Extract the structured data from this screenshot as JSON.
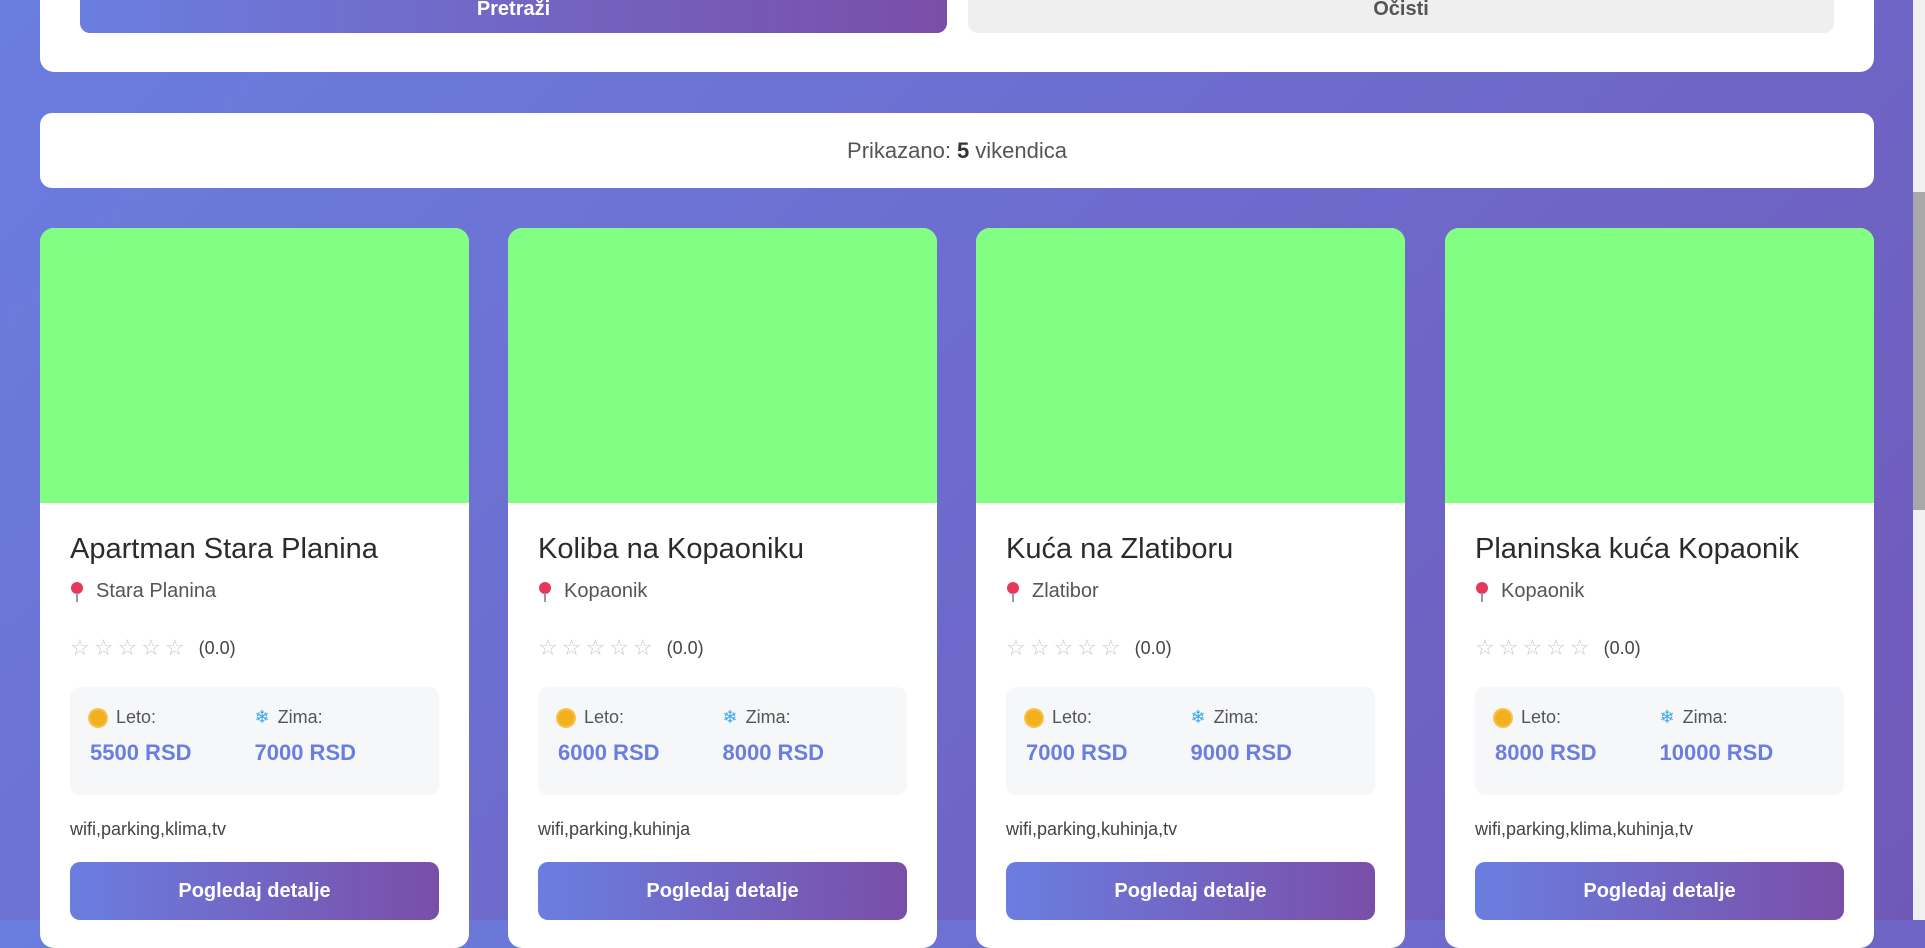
{
  "search": {
    "search_label": "Pretraži",
    "clear_label": "Očisti"
  },
  "results": {
    "prefix": "Prikazano:",
    "count": "5",
    "suffix": "vikendica"
  },
  "cards": [
    {
      "title": "Apartman Stara Planina",
      "location": "Stara Planina",
      "stars": "☆☆☆☆☆",
      "rating": "(0.0)",
      "summer_label": "Leto:",
      "summer_price": "5500 RSD",
      "winter_label": "Zima:",
      "winter_price": "7000 RSD",
      "amenities": "wifi,parking,klima,tv",
      "button": "Pogledaj detalje"
    },
    {
      "title": "Koliba na Kopaoniku",
      "location": "Kopaonik",
      "stars": "☆☆☆☆☆",
      "rating": "(0.0)",
      "summer_label": "Leto:",
      "summer_price": "6000 RSD",
      "winter_label": "Zima:",
      "winter_price": "8000 RSD",
      "amenities": "wifi,parking,kuhinja",
      "button": "Pogledaj detalje"
    },
    {
      "title": "Kuća na Zlatiboru",
      "location": "Zlatibor",
      "stars": "☆☆☆☆☆",
      "rating": "(0.0)",
      "summer_label": "Leto:",
      "summer_price": "7000 RSD",
      "winter_label": "Zima:",
      "winter_price": "9000 RSD",
      "amenities": "wifi,parking,kuhinja,tv",
      "button": "Pogledaj detalje"
    },
    {
      "title": "Planinska kuća Kopaonik",
      "location": "Kopaonik",
      "stars": "☆☆☆☆☆",
      "rating": "(0.0)",
      "summer_label": "Leto:",
      "summer_price": "8000 RSD",
      "winter_label": "Zima:",
      "winter_price": "10000 RSD",
      "amenities": "wifi,parking,klima,kuhinja,tv",
      "button": "Pogledaj detalje"
    }
  ],
  "colors": {
    "accent": "#6a7ee0",
    "accent_dark": "#7a4ea8",
    "image_placeholder": "#82fe82"
  }
}
